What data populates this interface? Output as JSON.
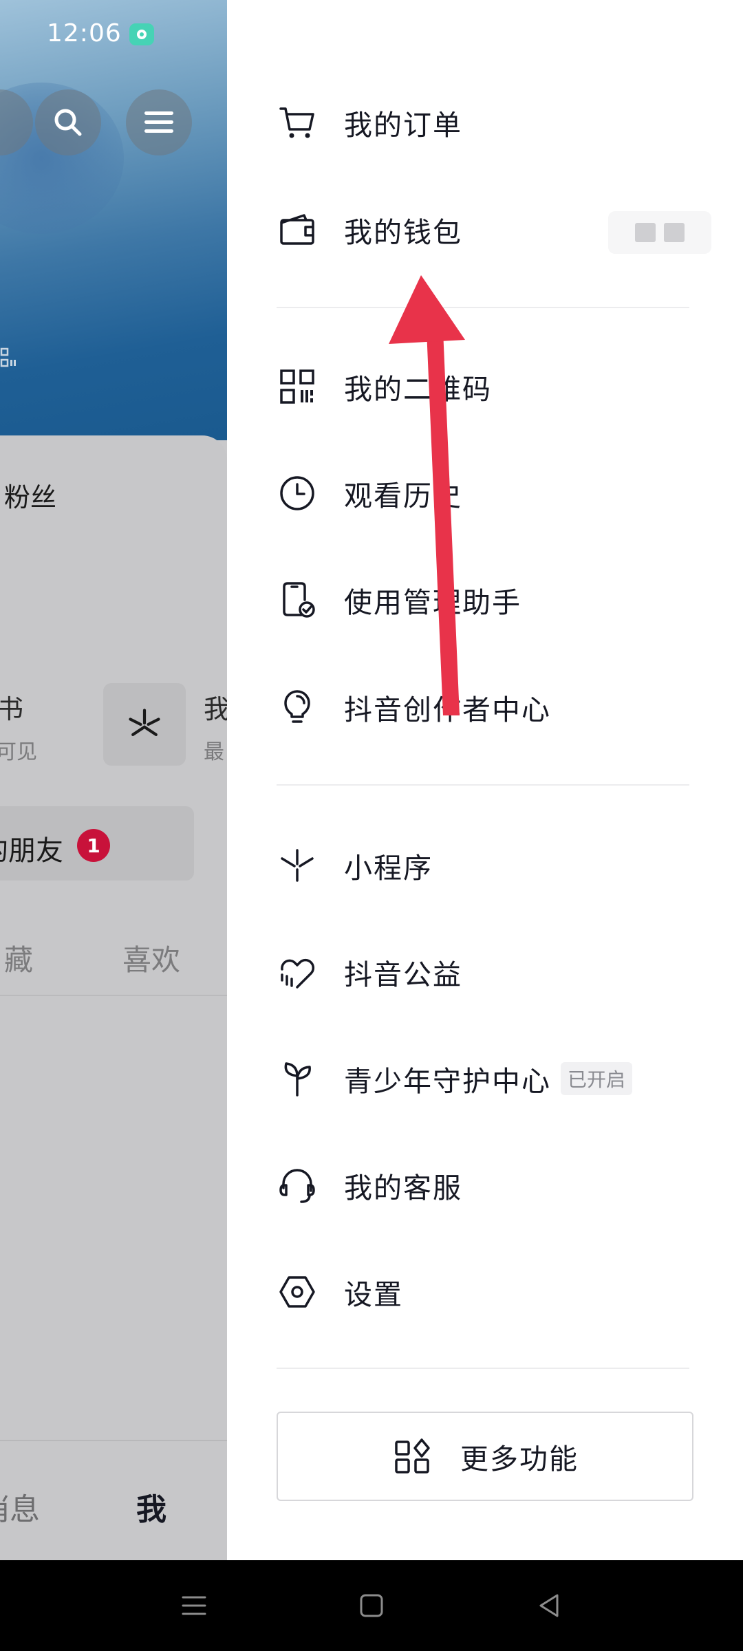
{
  "status_bar": {
    "time": "12:06"
  },
  "profile_bg": {
    "fans_label": "粉丝",
    "tile1_title": "书",
    "tile1_sub": "可见",
    "tile2_title": "我",
    "tile2_sub": "最",
    "friends_label": "的朋友",
    "friends_badge": "1",
    "tab_favorites": "藏",
    "tab_likes": "喜欢",
    "bottom_messages": "消息",
    "bottom_me": "我"
  },
  "drawer": {
    "group1": [
      {
        "label": "我的订单",
        "icon": "cart-icon"
      },
      {
        "label": "我的钱包",
        "icon": "wallet-icon"
      }
    ],
    "group2": [
      {
        "label": "我的二维码",
        "icon": "qr-code-icon"
      },
      {
        "label": "观看历史",
        "icon": "clock-icon"
      },
      {
        "label": "使用管理助手",
        "icon": "phone-check-icon"
      },
      {
        "label": "抖音创作者中心",
        "icon": "lightbulb-icon"
      }
    ],
    "group3": [
      {
        "label": "小程序",
        "icon": "mini-program-icon"
      },
      {
        "label": "抖音公益",
        "icon": "charity-heart-icon"
      },
      {
        "label": "青少年守护中心",
        "icon": "sprout-icon",
        "tag": "已开启"
      },
      {
        "label": "我的客服",
        "icon": "headset-icon"
      },
      {
        "label": "设置",
        "icon": "settings-hexagon-icon"
      }
    ],
    "more_button": {
      "label": "更多功能",
      "icon": "apps-grid-icon"
    }
  },
  "colors": {
    "drawer_bg": "#ffffff",
    "text_primary": "#161823",
    "annotation_arrow": "#e8334a",
    "badge_red": "#c8123a"
  }
}
